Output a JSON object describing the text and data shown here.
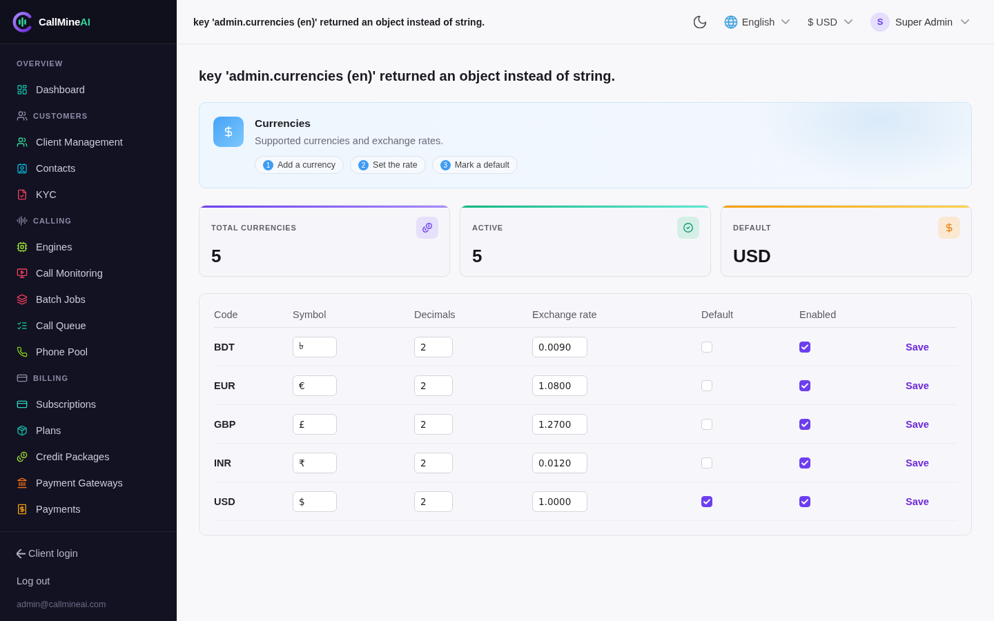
{
  "sidebar": {
    "logo": {
      "text": "CallMine",
      "accent": "AI"
    },
    "sections": [
      {
        "title": "OVERVIEW",
        "items": [
          {
            "label": "Dashboard",
            "selected": false
          }
        ]
      },
      {
        "title": "CUSTOMERS",
        "items": [
          {
            "label": "Client Management",
            "selected": false
          },
          {
            "label": "Contacts",
            "selected": false
          },
          {
            "label": "KYC",
            "selected": false
          }
        ]
      },
      {
        "title": "CALLING",
        "items": [
          {
            "label": "Engines",
            "selected": false
          },
          {
            "label": "Call Monitoring",
            "selected": false
          },
          {
            "label": "Batch Jobs",
            "selected": false
          },
          {
            "label": "Call Queue",
            "selected": false
          },
          {
            "label": "Phone Pool",
            "selected": false
          }
        ]
      },
      {
        "title": "BILLING",
        "items": [
          {
            "label": "Subscriptions",
            "selected": false
          },
          {
            "label": "Plans",
            "selected": false
          },
          {
            "label": "Credit Packages",
            "selected": false
          },
          {
            "label": "Payment Gateways",
            "selected": false
          },
          {
            "label": "Payments",
            "selected": false
          }
        ]
      }
    ],
    "footer": {
      "back_link": "Client login",
      "logout": "Log out",
      "email": "admin@callmineai.com"
    }
  },
  "header": {
    "title": "key 'admin.currencies (en)' returned an object instead of string.",
    "language": "English",
    "currency": "$ USD",
    "user": {
      "initial": "S",
      "name": "Super Admin"
    }
  },
  "page": {
    "title": "key 'admin.currencies (en)' returned an object instead of string.",
    "intro": {
      "title": "Currencies",
      "subtitle": "Supported currencies and exchange rates.",
      "steps": [
        {
          "number": "1",
          "label": "Add a currency"
        },
        {
          "number": "2",
          "label": "Set the rate"
        },
        {
          "number": "3",
          "label": "Mark a default"
        }
      ]
    },
    "stats": [
      {
        "label": "TOTAL CURRENCIES",
        "value": "5"
      },
      {
        "label": "ACTIVE",
        "value": "5"
      },
      {
        "label": "DEFAULT",
        "value": "USD"
      }
    ],
    "table": {
      "columns": [
        "Code",
        "Symbol",
        "Decimals",
        "Exchange rate",
        "Default",
        "Enabled"
      ],
      "rows": [
        {
          "code": "BDT",
          "symbol": "৳",
          "decimals": "2",
          "exchange_rate": "0.0090",
          "default": false,
          "enabled": true,
          "action": "Save"
        },
        {
          "code": "EUR",
          "symbol": "€",
          "decimals": "2",
          "exchange_rate": "1.0800",
          "default": false,
          "enabled": true,
          "action": "Save"
        },
        {
          "code": "GBP",
          "symbol": "£",
          "decimals": "2",
          "exchange_rate": "1.2700",
          "default": false,
          "enabled": true,
          "action": "Save"
        },
        {
          "code": "INR",
          "symbol": "₹",
          "decimals": "2",
          "exchange_rate": "0.0120",
          "default": false,
          "enabled": true,
          "action": "Save"
        },
        {
          "code": "USD",
          "symbol": "$",
          "decimals": "2",
          "exchange_rate": "1.0000",
          "default": true,
          "enabled": true,
          "action": "Save"
        }
      ]
    }
  }
}
